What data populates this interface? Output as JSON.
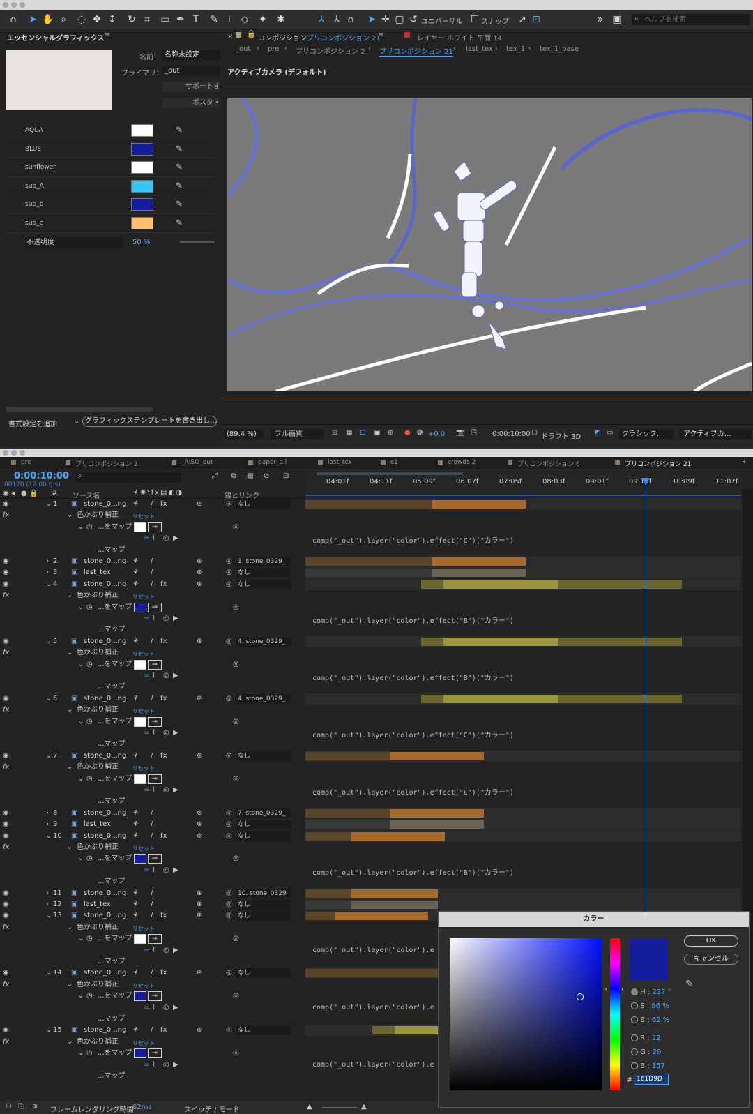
{
  "toolbar": {
    "universal": "ユニバーサル",
    "snap": "スナップ",
    "search_placeholder": "ヘルプを検索"
  },
  "essential": {
    "title": "エッセンシャルグラフィックス",
    "name_label": "名前：",
    "name_value": "名称未設定",
    "primary_label": "プライマリ：",
    "primary_value": "_out",
    "support_label": "サポートす",
    "poster_label": "ポスタ・",
    "colors": [
      {
        "label": "AQUA",
        "color": "#ffffff"
      },
      {
        "label": "BLUE",
        "color": "#161d9d"
      },
      {
        "label": "sunflower",
        "color": "#ffffff"
      },
      {
        "label": "sub_A",
        "color": "#38c3f5"
      },
      {
        "label": "sub_b",
        "color": "#161d9d"
      },
      {
        "label": "sub_c",
        "color": "#ffc16e"
      }
    ],
    "opacity_label": "不透明度",
    "opacity_value": "50 %",
    "format_btn": "書式設定を追加",
    "export_btn": "グラフィックステンプレートを書き出し..."
  },
  "viewer": {
    "comp_tab": "コンポジション",
    "comp_name": "プリコンポジション 21",
    "layer_tab": "レイヤー ホワイト 平面 14",
    "breadcrumbs": [
      "_out",
      "pre",
      "プリコンポジション 2",
      "プリコンポジション 21",
      "last_tex",
      "tex_1",
      "tex_1_base"
    ],
    "camera": "アクティブカメラ (デフォルト)",
    "zoom": "(89.4 %)",
    "quality": "フル画質",
    "exposure": "+0.0",
    "timecode": "0:00:10:00",
    "draft": "ドラフト 3D",
    "renderer": "クラシック...",
    "camera_menu": "アクティブカ..."
  },
  "timeline": {
    "tabs": [
      "pre",
      "プリコンポジション 2",
      "_RISO_out",
      "paper_all",
      "last_tex",
      "c1",
      "crowds 2",
      "プリコンポジション 6",
      "プリコンポジション 21"
    ],
    "timecode": "0:00:10:00",
    "frames": "00120 (12.00 fps)",
    "col_source": "ソース名",
    "col_parent": "親とリンク",
    "ruler": [
      "04:01f",
      "04:11f",
      "05:09f",
      "06:07f",
      "07:05f",
      "08:03f",
      "09:01f",
      "09:11f",
      "10:09f",
      "11:07f"
    ],
    "effect_name": "色かぶり補正",
    "reset": "リセット",
    "map_label": "...をマップ",
    "map2": "...マップ",
    "layers": [
      {
        "n": "1",
        "name": "stone_0...ng",
        "parent": "なし",
        "fx": true,
        "color": "#ffffff",
        "expr": "comp(\"_out\").layer(\"color\").effect(\"C\")(\"カラー\")"
      },
      {
        "n": "2",
        "name": "stone_0...ng",
        "parent": "1. stone_0329_"
      },
      {
        "n": "3",
        "name": "last_tex",
        "parent": "なし"
      },
      {
        "n": "4",
        "name": "stone_0...ng",
        "parent": "なし",
        "fx": true,
        "color": "#161d9d",
        "expr": "comp(\"_out\").layer(\"color\").effect(\"B\")(\"カラー\")"
      },
      {
        "n": "5",
        "name": "stone_0...ng",
        "parent": "4. stone_0329_",
        "fx": true,
        "color": "#ffffff",
        "expr": "comp(\"_out\").layer(\"color\").effect(\"B\")(\"カラー\")"
      },
      {
        "n": "6",
        "name": "stone_0...ng",
        "parent": "4. stone_0329_",
        "fx": true,
        "color": "#ffffff",
        "expr": "comp(\"_out\").layer(\"color\").effect(\"C\")(\"カラー\")"
      },
      {
        "n": "7",
        "name": "stone_0...ng",
        "parent": "なし",
        "fx": true,
        "color": "#ffffff",
        "expr": "comp(\"_out\").layer(\"color\").effect(\"C\")(\"カラー\")"
      },
      {
        "n": "8",
        "name": "stone_0...ng",
        "parent": "7. stone_0329_"
      },
      {
        "n": "9",
        "name": "last_tex",
        "parent": "なし"
      },
      {
        "n": "10",
        "name": "stone_0...ng",
        "parent": "なし",
        "fx": true,
        "color": "#161d9d",
        "expr": "comp(\"_out\").layer(\"color\").effect(\"B\")(\"カラー\")"
      },
      {
        "n": "11",
        "name": "stone_0...ng",
        "parent": "10. stone_0329"
      },
      {
        "n": "12",
        "name": "last_tex",
        "parent": "なし"
      },
      {
        "n": "13",
        "name": "stone_0...ng",
        "parent": "なし",
        "fx": true,
        "color": "#ffffff",
        "expr": "comp(\"_out\").layer(\"color\").e"
      },
      {
        "n": "14",
        "name": "stone_0...ng",
        "parent": "なし",
        "fx": true,
        "color": "#161d9d",
        "expr": "comp(\"_out\").layer(\"color\").e"
      },
      {
        "n": "15",
        "name": "stone_0...ng",
        "parent": "なし",
        "fx": true,
        "color": "#161d9d",
        "expr": "comp(\"_out\").layer(\"color\").e"
      }
    ],
    "status_render": "フレームレンダリング時間",
    "status_ms": "82ms",
    "status_switch": "スイッチ / モード"
  },
  "dialog": {
    "title": "カラー",
    "ok": "OK",
    "cancel": "キャンセル",
    "H": "237 °",
    "S": "86 %",
    "B": "62 %",
    "R": "22",
    "G": "29",
    "Bv": "157",
    "hex": "161D9D",
    "current_color": "#161d9d"
  }
}
